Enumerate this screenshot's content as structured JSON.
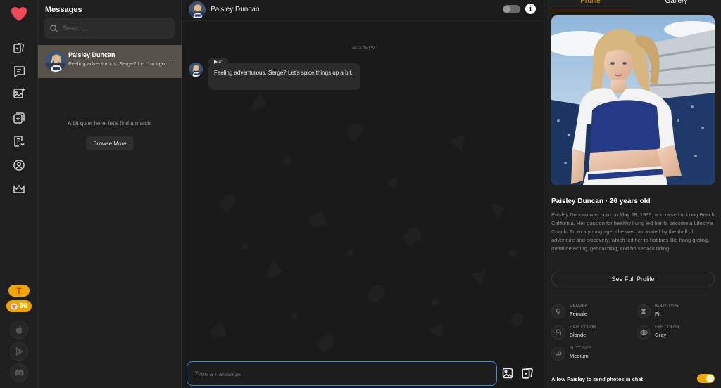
{
  "rail": {
    "token_letter": "T",
    "hearts_count": "50",
    "nav_icons": [
      "cards-icon",
      "chat-icon",
      "image-add-icon",
      "add-card-icon",
      "list-heart-icon",
      "user-circle-icon",
      "crown-icon"
    ],
    "bottom_icons": [
      "apple-icon",
      "play-store-icon",
      "discord-icon"
    ]
  },
  "messages": {
    "title": "Messages",
    "search_placeholder": "Search...",
    "conversations": [
      {
        "name": "Paisley Duncan",
        "preview": "Feeling adventurous, Serge? Le...",
        "time": "1m ago"
      }
    ],
    "empty_text": "A bit quiet here, let's find a match.",
    "browse_label": "Browse More"
  },
  "chat": {
    "contact_name": "Paisley Duncan",
    "timestamp": "Tue 2:45 PM",
    "audio_label": "4\"",
    "message_text": "Feeling adventurous, Serge? Let's spice things up a bit.",
    "composer_placeholder": "Type a message"
  },
  "profile": {
    "tabs": [
      "Profile",
      "Gallery"
    ],
    "active_tab": "Profile",
    "title": "Paisley Duncan · 26 years old",
    "bio": "Paisley Duncan was born on May 28, 1999, and raised in Long Beach, California. Her passion for healthy living led her to become a Lifestyle Coach. From a young age, she was fascinated by the thrill of adventure and discovery, which led her to hobbies like hang gliding, metal detecting, geocaching, and horseback riding.",
    "full_profile_label": "See Full Profile",
    "attributes": [
      {
        "key": "GENDER",
        "value": "Female",
        "icon": "gender-icon"
      },
      {
        "key": "BODY TYPE",
        "value": "Fit",
        "icon": "hourglass-icon"
      },
      {
        "key": "HAIR COLOR",
        "value": "Blonde",
        "icon": "hair-icon"
      },
      {
        "key": "EYE COLOR",
        "value": "Gray",
        "icon": "eye-icon"
      },
      {
        "key": "BUTT SIZE",
        "value": "Medium",
        "icon": "butt-icon"
      }
    ],
    "allow_photos_label": "Allow Paisley to send photos in chat",
    "allow_photos_on": true
  },
  "colors": {
    "accent": "#f0a500",
    "brand_heart": "#f04a5a",
    "composer_border": "#3d8ce6",
    "selected_conversation": "#56524b"
  }
}
